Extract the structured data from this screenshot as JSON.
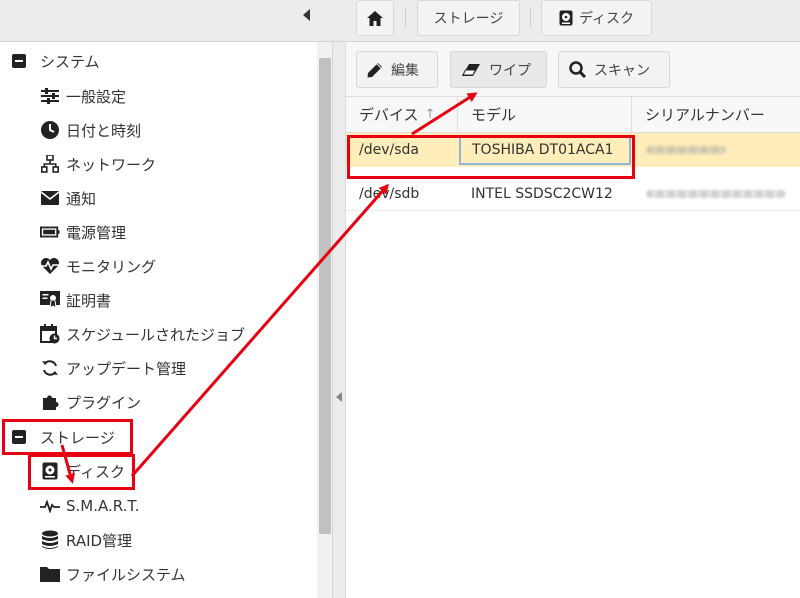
{
  "breadcrumb": {
    "home_icon": "home-icon",
    "items": [
      {
        "label": "ストレージ"
      },
      {
        "label": "ディスク",
        "icon": "disk-icon"
      }
    ]
  },
  "sidebar": {
    "categories": [
      {
        "label": "システム",
        "icon": "collapse-square-icon"
      },
      {
        "label": "ストレージ",
        "icon": "collapse-square-icon"
      }
    ],
    "system_items": [
      {
        "label": "一般設定",
        "icon": "sliders-icon"
      },
      {
        "label": "日付と時刻",
        "icon": "clock-icon"
      },
      {
        "label": "ネットワーク",
        "icon": "network-icon"
      },
      {
        "label": "通知",
        "icon": "envelope-icon"
      },
      {
        "label": "電源管理",
        "icon": "battery-icon"
      },
      {
        "label": "モニタリング",
        "icon": "heartbeat-icon"
      },
      {
        "label": "証明書",
        "icon": "certificate-icon"
      },
      {
        "label": "スケジュールされたジョブ",
        "icon": "calendar-clock-icon"
      },
      {
        "label": "アップデート管理",
        "icon": "refresh-icon"
      },
      {
        "label": "プラグイン",
        "icon": "puzzle-icon"
      }
    ],
    "storage_items": [
      {
        "label": "ディスク",
        "icon": "disk-icon"
      },
      {
        "label": "S.M.A.R.T.",
        "icon": "pulse-icon"
      },
      {
        "label": "RAID管理",
        "icon": "database-icon"
      },
      {
        "label": "ファイルシステム",
        "icon": "folder-icon"
      }
    ]
  },
  "toolbar": {
    "edit_label": "編集",
    "wipe_label": "ワイプ",
    "scan_label": "スキャン"
  },
  "table": {
    "columns": [
      "デバイス",
      "モデル",
      "シリアルナンバー"
    ],
    "sort_indicator": "↑",
    "rows": [
      {
        "device": "/dev/sda",
        "model": "TOSHIBA DT01ACA1",
        "serial": "",
        "selected": true
      },
      {
        "device": "/dev/sdb",
        "model": "INTEL SSDSC2CW12",
        "serial": "",
        "selected": false
      }
    ]
  },
  "colors": {
    "highlight": "#e60012",
    "selected_row": "#ffeeb9",
    "topbar": "#ececec"
  }
}
